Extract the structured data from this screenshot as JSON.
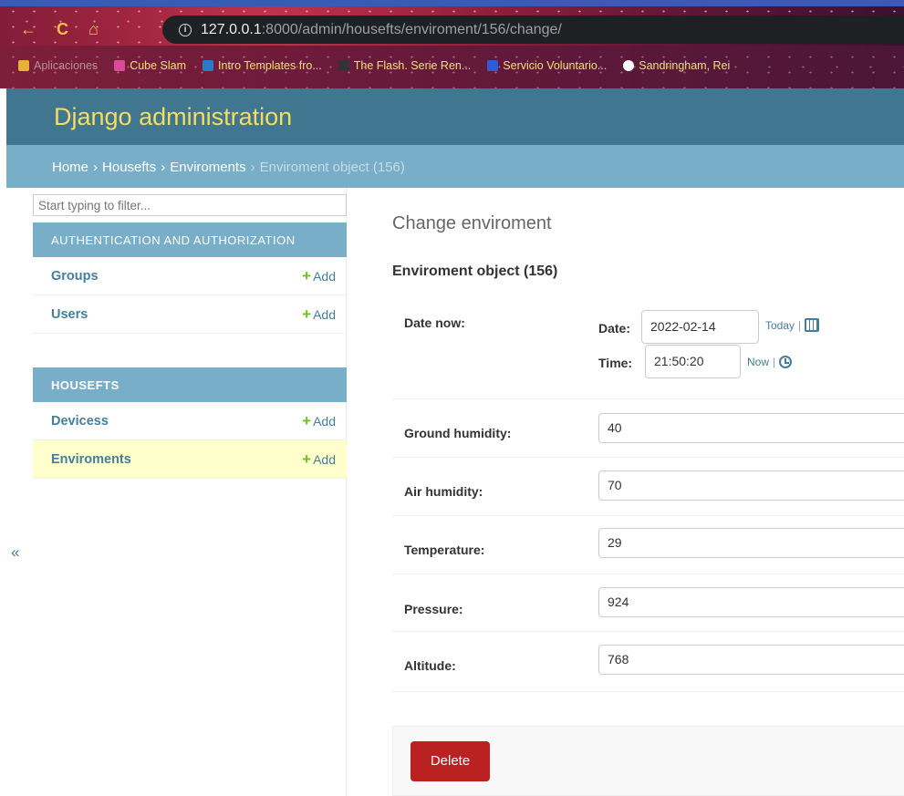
{
  "browser": {
    "url_host": "127.0.0.1",
    "url_rest": ":8000/admin/housefts/enviroment/156/change/",
    "bookmarks": [
      {
        "label": "Aplicaciones",
        "color": "#e8b23a"
      },
      {
        "label": "Cube Slam",
        "color": "#d94a9a"
      },
      {
        "label": "Intro Templates fro...",
        "color": "#2a7ac7"
      },
      {
        "label": "The Flash. Serie Ren...",
        "color": "#333333"
      },
      {
        "label": "Servicio Voluntario...",
        "color": "#2f5bd3"
      },
      {
        "label": "Sandringham, Rei",
        "color": "#ffffff"
      }
    ]
  },
  "header": {
    "site_title": "Django administration"
  },
  "breadcrumbs": {
    "home": "Home",
    "app": "Housefts",
    "model": "Enviroments",
    "current": "Enviroment object (156)"
  },
  "sidebar": {
    "filter_placeholder": "Start typing to filter...",
    "add_label": "Add",
    "collapse_label": "«",
    "modules": [
      {
        "caption": "AUTHENTICATION AND AUTHORIZATION",
        "models": [
          "Groups",
          "Users"
        ]
      },
      {
        "caption": "HOUSEFTS",
        "models": [
          "Devicess",
          "Enviroments"
        ]
      }
    ]
  },
  "content": {
    "page_title": "Change enviroment",
    "object_title": "Enviroment object (156)",
    "date_now_label": "Date now:",
    "date_label": "Date:",
    "date_value": "2022-02-14",
    "today_link": "Today",
    "time_label": "Time:",
    "time_value": "21:50:20",
    "now_link": "Now",
    "fields": [
      {
        "label": "Ground humidity:",
        "value": "40"
      },
      {
        "label": "Air humidity:",
        "value": "70"
      },
      {
        "label": "Temperature:",
        "value": "29"
      },
      {
        "label": "Pressure:",
        "value": "924"
      },
      {
        "label": "Altitude:",
        "value": "768"
      }
    ],
    "delete_label": "Delete"
  },
  "colors": {
    "header": "#417690",
    "breadcrumbs": "#79aec8",
    "title_yellow": "#f5dd5d",
    "link": "#447e9b",
    "add_green": "#70bf2b",
    "delete_red": "#ba2121",
    "current_row": "#ffffcc"
  }
}
